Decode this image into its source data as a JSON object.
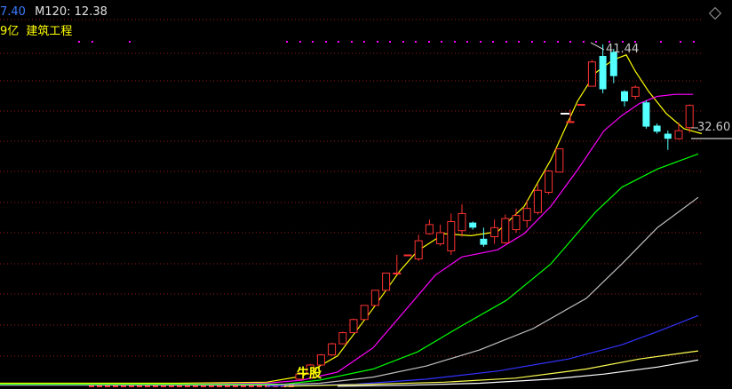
{
  "header": {
    "volume_value": "7.40",
    "m120_label": "M120:",
    "m120_value": "12.38",
    "amount_fragment": "9亿",
    "sector_name": "建筑工程"
  },
  "labels": {
    "high_price": "41.44",
    "current_price": "32.60",
    "bottom_tag": "牛股"
  },
  "colors": {
    "background": "#000000",
    "up_candle": "#ff3232",
    "down_candle": "#54ffff",
    "grid_dots": "#9a1a1a",
    "signal_dots": "#ff00ff",
    "ma5": "#ffff00",
    "ma10": "#ff00ff",
    "ma20": "#00ff00",
    "ma30": "#c0c0c0",
    "ma60": "#3232ff",
    "ma120_a": "#ffff50",
    "ma120_b": "#ffffff"
  },
  "chart_data": {
    "type": "candlestick",
    "price_labels": {
      "high": 41.44,
      "last": 32.6
    },
    "candles": [
      {
        "o": 8.3,
        "c": 8.8,
        "h": 9.0,
        "l": 8.2
      },
      {
        "o": 8.8,
        "c": 9.7,
        "h": 9.8,
        "l": 8.8
      },
      {
        "o": 9.7,
        "c": 10.7,
        "h": 10.8,
        "l": 9.6
      },
      {
        "o": 10.7,
        "c": 11.8,
        "h": 11.9,
        "l": 10.6
      },
      {
        "o": 11.8,
        "c": 12.9,
        "h": 13.0,
        "l": 11.8
      },
      {
        "o": 12.9,
        "c": 14.2,
        "h": 14.3,
        "l": 12.9
      },
      {
        "o": 14.2,
        "c": 15.6,
        "h": 15.6,
        "l": 14.2
      },
      {
        "o": 15.6,
        "c": 17.1,
        "h": 17.1,
        "l": 15.5
      },
      {
        "o": 17.1,
        "c": 18.8,
        "h": 18.8,
        "l": 17.0
      },
      {
        "o": 18.8,
        "c": 18.8,
        "h": 20.6,
        "l": 18.8
      },
      {
        "o": 20.6,
        "c": 20.6,
        "h": 20.6,
        "l": 20.6
      },
      {
        "o": 20.2,
        "c": 22.0,
        "h": 22.6,
        "l": 20.0
      },
      {
        "o": 22.7,
        "c": 23.6,
        "h": 24.1,
        "l": 22.6
      },
      {
        "o": 21.7,
        "c": 22.8,
        "h": 23.6,
        "l": 21.5
      },
      {
        "o": 21.0,
        "c": 23.9,
        "h": 24.7,
        "l": 20.6
      },
      {
        "o": 23.0,
        "c": 24.7,
        "h": 25.6,
        "l": 22.4
      },
      {
        "o": 23.8,
        "c": 23.3,
        "h": 23.9,
        "l": 23.1
      },
      {
        "o": 22.2,
        "c": 21.6,
        "h": 23.3,
        "l": 21.4
      },
      {
        "o": 22.4,
        "c": 23.3,
        "h": 24.1,
        "l": 21.7
      },
      {
        "o": 21.8,
        "c": 24.2,
        "h": 24.6,
        "l": 21.7
      },
      {
        "o": 23.1,
        "c": 24.5,
        "h": 25.2,
        "l": 22.8
      },
      {
        "o": 24.0,
        "c": 25.2,
        "h": 26.0,
        "l": 23.3
      },
      {
        "o": 24.8,
        "c": 27.0,
        "h": 27.6,
        "l": 24.6
      },
      {
        "o": 26.8,
        "c": 28.9,
        "h": 29.0,
        "l": 26.6
      },
      {
        "o": 28.8,
        "c": 31.1,
        "h": 31.1,
        "l": 28.8
      },
      {
        "o": 33.8,
        "c": 33.8,
        "h": 35.0,
        "l": 33.8
      },
      {
        "o": 35.5,
        "c": 35.5,
        "h": 35.5,
        "l": 35.5
      },
      {
        "o": 37.3,
        "c": 39.7,
        "h": 39.9,
        "l": 37.3
      },
      {
        "o": 40.3,
        "c": 37.0,
        "h": 41.44,
        "l": 36.6
      },
      {
        "o": 40.7,
        "c": 38.3,
        "h": 41.0,
        "l": 37.6
      },
      {
        "o": 36.8,
        "c": 35.8,
        "h": 36.9,
        "l": 35.3
      },
      {
        "o": 36.3,
        "c": 37.2,
        "h": 37.4,
        "l": 36.0
      },
      {
        "o": 35.7,
        "c": 33.3,
        "h": 35.9,
        "l": 33.1
      },
      {
        "o": 33.4,
        "c": 32.8,
        "h": 33.6,
        "l": 32.6
      },
      {
        "o": 32.6,
        "c": 32.1,
        "h": 32.9,
        "l": 31.0
      },
      {
        "o": 32.1,
        "c": 32.9,
        "h": 33.7,
        "l": 32.0
      },
      {
        "o": 33.2,
        "c": 35.4,
        "h": 35.5,
        "l": 32.7
      }
    ],
    "base_candles_note": "flat low-priced candles along the bottom edge before the rally",
    "moving_averages": {
      "ma5": [
        [
          0,
          7.9
        ],
        [
          100,
          7.9
        ],
        [
          200,
          7.9
        ],
        [
          300,
          8.0
        ],
        [
          340,
          8.6
        ],
        [
          380,
          10.6
        ],
        [
          420,
          15.3
        ],
        [
          450,
          19.0
        ],
        [
          470,
          21.0
        ],
        [
          500,
          22.7
        ],
        [
          530,
          22.5
        ],
        [
          560,
          22.9
        ],
        [
          590,
          25.4
        ],
        [
          620,
          30.0
        ],
        [
          650,
          35.8
        ],
        [
          670,
          38.6
        ],
        [
          690,
          39.9
        ],
        [
          705,
          40.4
        ],
        [
          715,
          38.8
        ],
        [
          730,
          36.8
        ],
        [
          750,
          34.6
        ],
        [
          770,
          33.1
        ],
        [
          790,
          32.6
        ]
      ],
      "ma10": [
        [
          0,
          7.8
        ],
        [
          100,
          7.8
        ],
        [
          200,
          7.8
        ],
        [
          300,
          7.9
        ],
        [
          340,
          8.2
        ],
        [
          380,
          9.0
        ],
        [
          420,
          11.4
        ],
        [
          460,
          15.5
        ],
        [
          490,
          18.6
        ],
        [
          520,
          20.4
        ],
        [
          560,
          21.1
        ],
        [
          590,
          22.7
        ],
        [
          620,
          25.4
        ],
        [
          650,
          29.0
        ],
        [
          680,
          32.9
        ],
        [
          700,
          34.4
        ],
        [
          720,
          35.6
        ],
        [
          740,
          36.3
        ],
        [
          760,
          36.5
        ],
        [
          780,
          36.5
        ]
      ],
      "ma20": [
        [
          0,
          7.8
        ],
        [
          100,
          7.8
        ],
        [
          200,
          7.8
        ],
        [
          320,
          7.8
        ],
        [
          360,
          8.2
        ],
        [
          420,
          9.3
        ],
        [
          470,
          11.0
        ],
        [
          520,
          13.6
        ],
        [
          570,
          16.1
        ],
        [
          620,
          19.7
        ],
        [
          670,
          24.8
        ],
        [
          700,
          27.3
        ],
        [
          740,
          29.1
        ],
        [
          786,
          30.6
        ]
      ],
      "ma30": [
        [
          0,
          7.7
        ],
        [
          150,
          7.7
        ],
        [
          300,
          7.7
        ],
        [
          360,
          7.9
        ],
        [
          420,
          8.5
        ],
        [
          480,
          9.6
        ],
        [
          540,
          11.2
        ],
        [
          600,
          13.3
        ],
        [
          660,
          16.3
        ],
        [
          700,
          19.7
        ],
        [
          740,
          23.3
        ],
        [
          786,
          26.3
        ]
      ],
      "ma60": [
        [
          300,
          7.6
        ],
        [
          400,
          7.8
        ],
        [
          480,
          8.3
        ],
        [
          560,
          9.1
        ],
        [
          640,
          10.3
        ],
        [
          700,
          11.7
        ],
        [
          740,
          13.0
        ],
        [
          786,
          14.6
        ]
      ],
      "ma120_a": [
        [
          320,
          7.6
        ],
        [
          420,
          7.8
        ],
        [
          500,
          8.0
        ],
        [
          580,
          8.4
        ],
        [
          660,
          9.3
        ],
        [
          720,
          10.3
        ],
        [
          786,
          11.1
        ]
      ],
      "ma120_b": [
        [
          380,
          7.6
        ],
        [
          460,
          7.7
        ],
        [
          540,
          7.9
        ],
        [
          620,
          8.3
        ],
        [
          680,
          8.8
        ],
        [
          740,
          9.5
        ],
        [
          786,
          10.2
        ]
      ]
    }
  }
}
